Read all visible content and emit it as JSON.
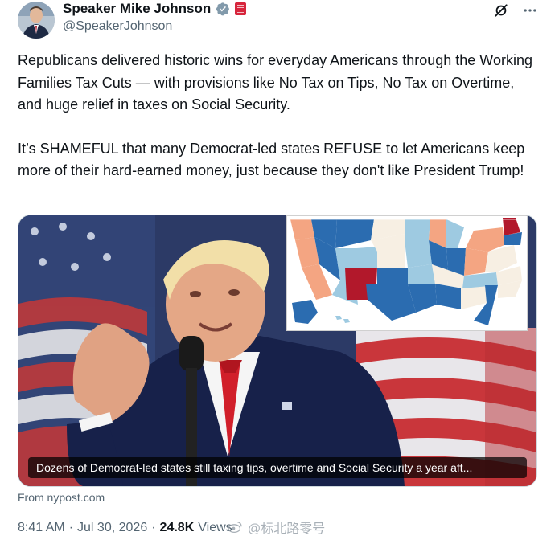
{
  "author": {
    "display_name": "Speaker Mike Johnson",
    "handle": "@SpeakerJohnson",
    "verified_icon": "verified-badge-icon",
    "affiliation_icon": "flag-badge-icon"
  },
  "header_actions": {
    "grok_icon": "grok-icon",
    "more_icon": "more-icon"
  },
  "tweet": {
    "paragraphs": [
      "Republicans delivered historic wins for everyday Americans through the Working Families Tax Cuts — with provisions like No Tax on Tips, No Tax on Overtime, and huge relief in taxes on Social Security.",
      "It’s SHAMEFUL that many Democrat-led states REFUSE to let Americans keep more of their hard-earned money, just because they don't like President Trump!"
    ]
  },
  "card": {
    "caption": "Dozens of Democrat-led states still taxing tips, overtime and Social Security a year aft...",
    "source": "From nypost.com"
  },
  "meta": {
    "time": "8:41 AM",
    "separator": "·",
    "date": "Jul 30, 2026",
    "views_count": "24.8K",
    "views_label": "Views"
  },
  "watermark": {
    "text": "@标北路零号"
  },
  "colors": {
    "text_primary": "#0f1419",
    "text_secondary": "#536471",
    "verified_blue": "#1d9bf0",
    "map_dark_blue": "#2b6cb0",
    "map_light_blue": "#9ecae1",
    "map_red": "#b2182b",
    "map_salmon": "#f4a582",
    "map_beige": "#f7efe3"
  }
}
